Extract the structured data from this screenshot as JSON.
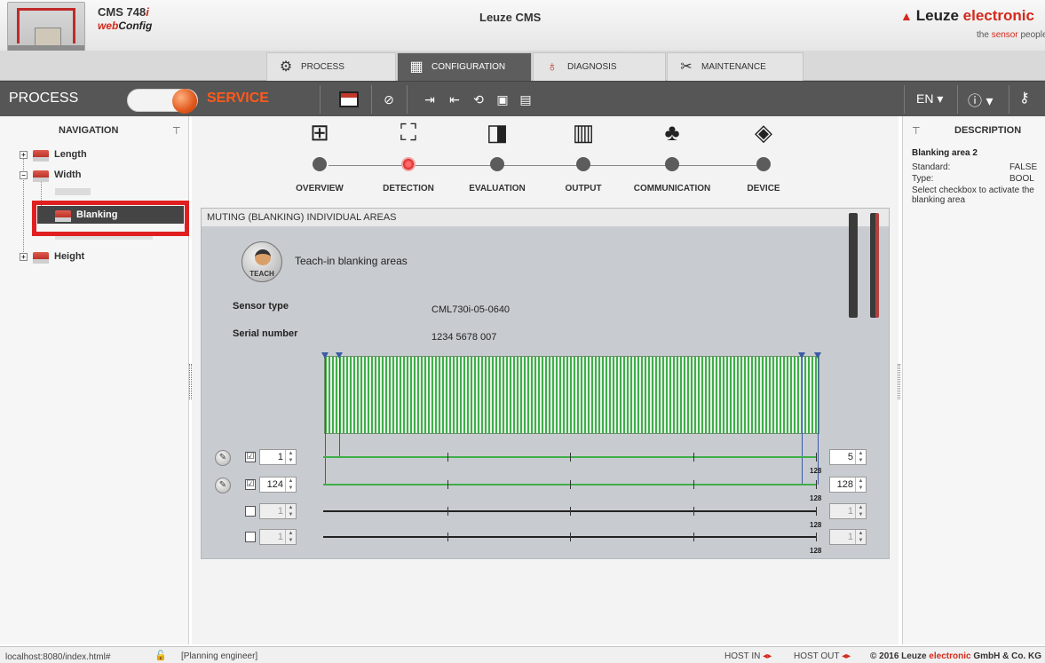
{
  "header": {
    "app_name": "CMS 748",
    "app_name_accent": "i",
    "app_sub_prefix": "web",
    "app_sub_suffix": "Config",
    "center_title": "Leuze CMS",
    "brand_prefix": "Leuze ",
    "brand_accent": "electronic",
    "tagline_prefix": "the ",
    "tagline_accent": "sensor",
    "tagline_suffix": " people"
  },
  "tabs": [
    {
      "label": "PROCESS",
      "icon": "process-icon"
    },
    {
      "label": "CONFIGURATION",
      "icon": "configuration-icon"
    },
    {
      "label": "DIAGNOSIS",
      "icon": "diagnosis-icon"
    },
    {
      "label": "MAINTENANCE",
      "icon": "maintenance-icon"
    }
  ],
  "toolbar": {
    "process_label": "PROCESS",
    "service_label": "SERVICE",
    "lang": "EN"
  },
  "nav": {
    "title": "NAVIGATION",
    "items": [
      {
        "label": "Length"
      },
      {
        "label": "Width"
      },
      {
        "label": "Blanking"
      },
      {
        "label": "Height"
      }
    ]
  },
  "steps": [
    {
      "label": "OVERVIEW"
    },
    {
      "label": "DETECTION"
    },
    {
      "label": "EVALUATION"
    },
    {
      "label": "OUTPUT"
    },
    {
      "label": "COMMUNICATION"
    },
    {
      "label": "DEVICE"
    }
  ],
  "card": {
    "title": "MUTING (BLANKING) INDIVIDUAL AREAS",
    "teach_label": "Teach-in blanking areas",
    "teach_badge": "TEACH",
    "sensor_type_label": "Sensor type",
    "sensor_type_value": "CML730i-05-0640",
    "serial_label": "Serial number",
    "serial_value": "1234 5678 007",
    "rows": [
      {
        "checked": "☑",
        "from": "1",
        "to": "5",
        "end": "128",
        "start": "1"
      },
      {
        "checked": "☑",
        "from": "124",
        "to": "128",
        "end": "128",
        "start": "1"
      },
      {
        "checked": "",
        "from": "1",
        "to": "1",
        "end": "128",
        "start": "1"
      },
      {
        "checked": "",
        "from": "1",
        "to": "1",
        "end": "128",
        "start": "1"
      }
    ]
  },
  "description": {
    "title": "DESCRIPTION",
    "item_title": "Blanking area 2",
    "standard_label": "Standard:",
    "standard_value": "FALSE",
    "type_label": "Type:",
    "type_value": "BOOL",
    "text": "Select checkbox to activate the blanking area"
  },
  "statusbar": {
    "url": "localhost:8080/index.html#",
    "role": "[Planning engineer]",
    "host_in": "HOST IN",
    "host_out": "HOST OUT",
    "copyright_prefix": "© 2016 Leuze ",
    "copyright_accent": "electronic",
    "copyright_suffix": " GmbH & Co. KG"
  },
  "colors": {
    "accent": "#d4291b",
    "toolbar": "#565656",
    "beam": "#3fae4a",
    "highlight": "#e02020"
  }
}
